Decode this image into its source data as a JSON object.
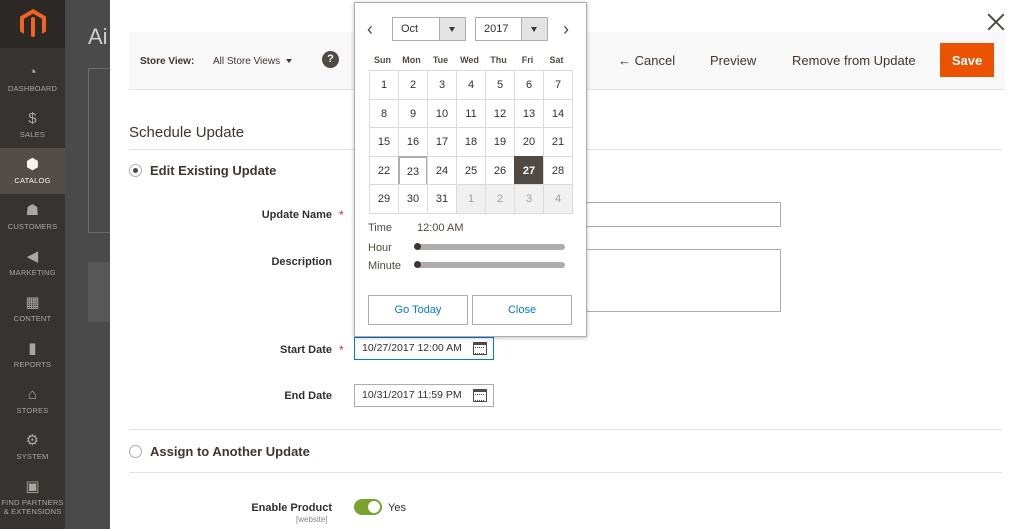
{
  "sidebar": {
    "items": [
      {
        "label": "DASHBOARD",
        "icon": "dashboard-icon",
        "glyph": "◔"
      },
      {
        "label": "SALES",
        "icon": "dollar-icon",
        "glyph": "$"
      },
      {
        "label": "CATALOG",
        "icon": "cube-icon",
        "glyph": "⬢"
      },
      {
        "label": "CUSTOMERS",
        "icon": "person-icon",
        "glyph": "☗"
      },
      {
        "label": "MARKETING",
        "icon": "megaphone-icon",
        "glyph": "◀"
      },
      {
        "label": "CONTENT",
        "icon": "layout-icon",
        "glyph": "▦"
      },
      {
        "label": "REPORTS",
        "icon": "bar-chart-icon",
        "glyph": "▮"
      },
      {
        "label": "STORES",
        "icon": "store-icon",
        "glyph": "⌂"
      },
      {
        "label": "SYSTEM",
        "icon": "gear-icon",
        "glyph": "⚙"
      },
      {
        "label": "FIND PARTNERS & EXTENSIONS",
        "icon": "box-icon",
        "glyph": "▣"
      }
    ],
    "active": "CATALOG"
  },
  "background": {
    "title": "Ai"
  },
  "toolbar": {
    "store_view_label": "Store View:",
    "store_view_value": "All Store Views",
    "help": "?",
    "cancel_label": "← Cancel",
    "preview_label": "Preview",
    "remove_label": "Remove from Update",
    "save_label": "Save"
  },
  "form": {
    "section_title": "Schedule Update",
    "edit_existing_label": "Edit Existing Update",
    "assign_label": "Assign to Another Update",
    "update_name_label": "Update Name",
    "description_label": "Description",
    "start_date_label": "Start Date",
    "start_date_value": "10/27/2017 12:00 AM",
    "end_date_label": "End Date",
    "end_date_value": "10/31/2017 11:59 PM",
    "enable_product_label": "Enable Product",
    "enable_product_scope": "[website]",
    "enable_product_value": "Yes",
    "required_mark": "*"
  },
  "datepicker": {
    "prev": "‹",
    "next": "›",
    "month": "Oct",
    "year": "2017",
    "weekdays": [
      "Sun",
      "Mon",
      "Tue",
      "Wed",
      "Thu",
      "Fri",
      "Sat"
    ],
    "weeks": [
      [
        {
          "d": "1"
        },
        {
          "d": "2"
        },
        {
          "d": "3"
        },
        {
          "d": "4"
        },
        {
          "d": "5"
        },
        {
          "d": "6"
        },
        {
          "d": "7"
        }
      ],
      [
        {
          "d": "8"
        },
        {
          "d": "9"
        },
        {
          "d": "10"
        },
        {
          "d": "11"
        },
        {
          "d": "12"
        },
        {
          "d": "13"
        },
        {
          "d": "14"
        }
      ],
      [
        {
          "d": "15"
        },
        {
          "d": "16"
        },
        {
          "d": "17"
        },
        {
          "d": "18"
        },
        {
          "d": "19"
        },
        {
          "d": "20"
        },
        {
          "d": "21"
        }
      ],
      [
        {
          "d": "22"
        },
        {
          "d": "23",
          "state": "today"
        },
        {
          "d": "24"
        },
        {
          "d": "25"
        },
        {
          "d": "26"
        },
        {
          "d": "27",
          "state": "sel"
        },
        {
          "d": "28"
        }
      ],
      [
        {
          "d": "29"
        },
        {
          "d": "30"
        },
        {
          "d": "31"
        },
        {
          "d": "1",
          "state": "other"
        },
        {
          "d": "2",
          "state": "other"
        },
        {
          "d": "3",
          "state": "other"
        },
        {
          "d": "4",
          "state": "other"
        }
      ]
    ],
    "time_label": "Time",
    "time_value": "12:00 AM",
    "hour_label": "Hour",
    "minute_label": "Minute",
    "hour_value": 0,
    "minute_value": 0,
    "go_today_label": "Go Today",
    "close_label": "Close"
  },
  "colors": {
    "accent": "#eb5202",
    "link": "#007bdb",
    "selected_day": "#514943",
    "toggle_on": "#79a22e"
  }
}
